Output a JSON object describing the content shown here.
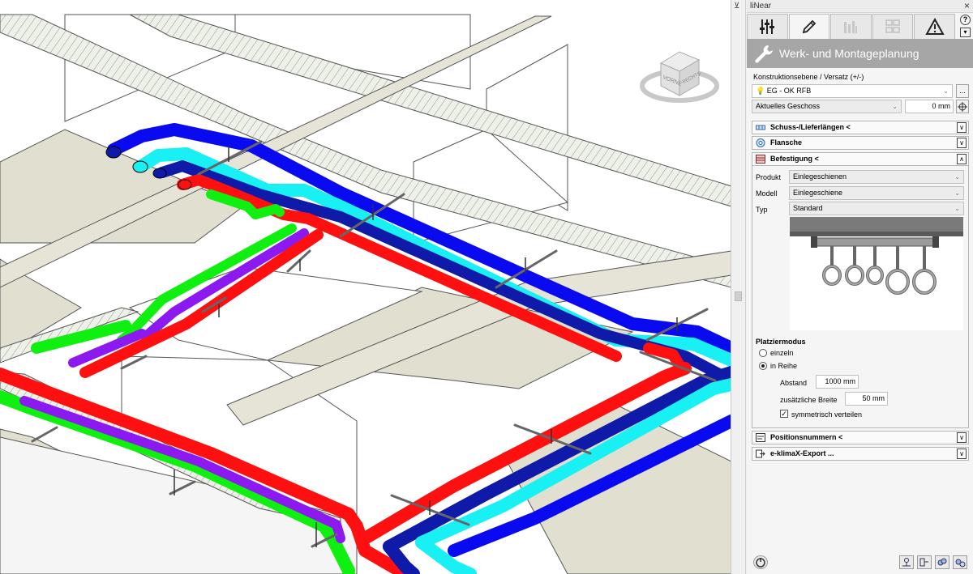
{
  "panel": {
    "title": "liNear",
    "close": "×",
    "pin": "⊻",
    "help": "?",
    "menu_arrow": "▾",
    "header_title": "Werk- und Montageplanung",
    "tabs": [
      {
        "icon": "sliders-icon",
        "active": false
      },
      {
        "icon": "pencil-icon",
        "active": true
      },
      {
        "icon": "bar-chart-icon",
        "active": false
      },
      {
        "icon": "grid-icon",
        "active": false
      },
      {
        "icon": "warning-icon",
        "active": false
      }
    ],
    "construction_label": "Konstruktionsebene / Versatz (+/-)",
    "level_value": "EG - OK RFB",
    "dots_button": "...",
    "floor_value": "Aktuelles Geschoss",
    "offset_value": "0 mm",
    "sections": {
      "schuss": "Schuss-/Lieferlängen <",
      "flansche": "Flansche",
      "befestigung": "Befestigung <",
      "positionsnummern": "Positionsnummern <",
      "export": "e-klimaX-Export ..."
    },
    "befestigung": {
      "produkt_label": "Produkt",
      "produkt_value": "Einlegeschienen",
      "modell_label": "Modell",
      "modell_value": "Einlegeschiene",
      "typ_label": "Typ",
      "typ_value": "Standard",
      "placement_title": "Platziermodus",
      "option_single": "einzeln",
      "option_row": "in Reihe",
      "abstand_label": "Abstand",
      "abstand_value": "1000 mm",
      "breite_label": "zusätzliche Breite",
      "breite_value": "50 mm",
      "symmetric_label": "symmetrisch verteilen",
      "symmetric_checked": true,
      "selected_mode": "in Reihe"
    }
  },
  "viewcube": {
    "face_front": "VORNE",
    "face_right": "RECHTS"
  },
  "colors": {
    "blue": "#0a0af0",
    "cyan": "#18f0f4",
    "navy": "#101aa8",
    "red": "#ff1010",
    "green": "#10f010",
    "purple": "#8c1af0",
    "floor": "#e0dfd0",
    "header_grey": "#a6a6a6"
  }
}
